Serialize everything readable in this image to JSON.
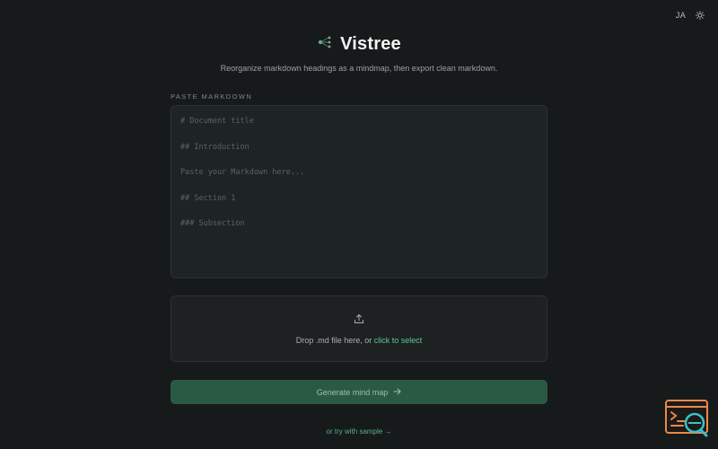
{
  "header": {
    "language_label": "JA",
    "theme_icon": "sun-icon"
  },
  "brand": {
    "logo_icon": "tree-branch-icon",
    "title": "Vistree",
    "tagline": "Reorganize markdown headings as a mindmap, then export clean markdown."
  },
  "editor": {
    "label": "PASTE MARKDOWN",
    "placeholder_lines": [
      "# Document title",
      "## Introduction",
      "Paste your Markdown here...",
      "## Section 1",
      "### Subsection"
    ]
  },
  "dropzone": {
    "icon": "upload-icon",
    "text": "Drop .md file here, or ",
    "link_text": "click to select"
  },
  "actions": {
    "generate_label": "Generate mind map",
    "generate_icon": "arrow-right-icon",
    "sample_link": "or try with sample →"
  },
  "colors": {
    "background": "#171a1b",
    "accent": "#5fc796",
    "button": "#2a5a43",
    "widget_orange": "#e8894a",
    "widget_teal": "#39c2c9"
  }
}
